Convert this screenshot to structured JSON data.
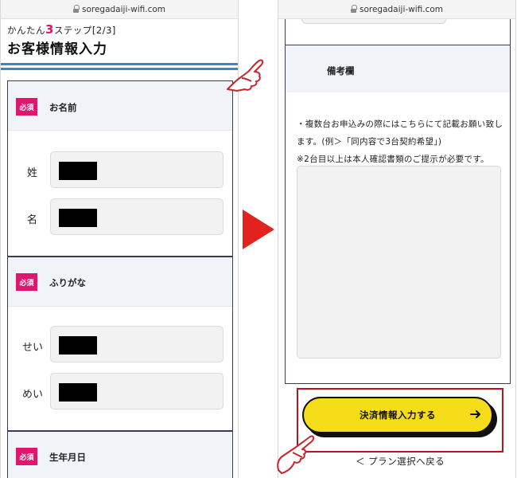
{
  "left_screen": {
    "url": "soregadaiji-wifi.com",
    "step_label": {
      "prefix": "かんたん",
      "number": "3",
      "suffix": "ステップ[2/3]"
    },
    "page_title": "お客様情報入力",
    "sections": [
      {
        "badge": "必須",
        "title": "お名前",
        "fields": [
          {
            "label": "姓"
          },
          {
            "label": "名"
          }
        ]
      },
      {
        "badge": "必須",
        "title": "ふりがな",
        "fields": [
          {
            "label": "せい"
          },
          {
            "label": "めい"
          }
        ]
      },
      {
        "badge": "必須",
        "title": "生年月日",
        "fields": []
      }
    ]
  },
  "right_screen": {
    "url": "soregadaiji-wifi.com",
    "remarks_title": "備考欄",
    "remarks_note_line1": "・複数台お申込みの際にはこちらにて記載お願い致します。(例＞「同内容で3台契約希望」)",
    "remarks_note_line2": "※2台目以上は本人確認書類のご提示が必要です。",
    "submit_button": "決済情報入力する",
    "back_link": "＜ プラン選択へ戻る"
  },
  "colors": {
    "required_badge": "#e0166e",
    "accent_blue": "#3b86c8",
    "arrow_red": "#e0231f",
    "button_yellow": "#f5dd19",
    "highlight_frame": "#b5161c"
  }
}
